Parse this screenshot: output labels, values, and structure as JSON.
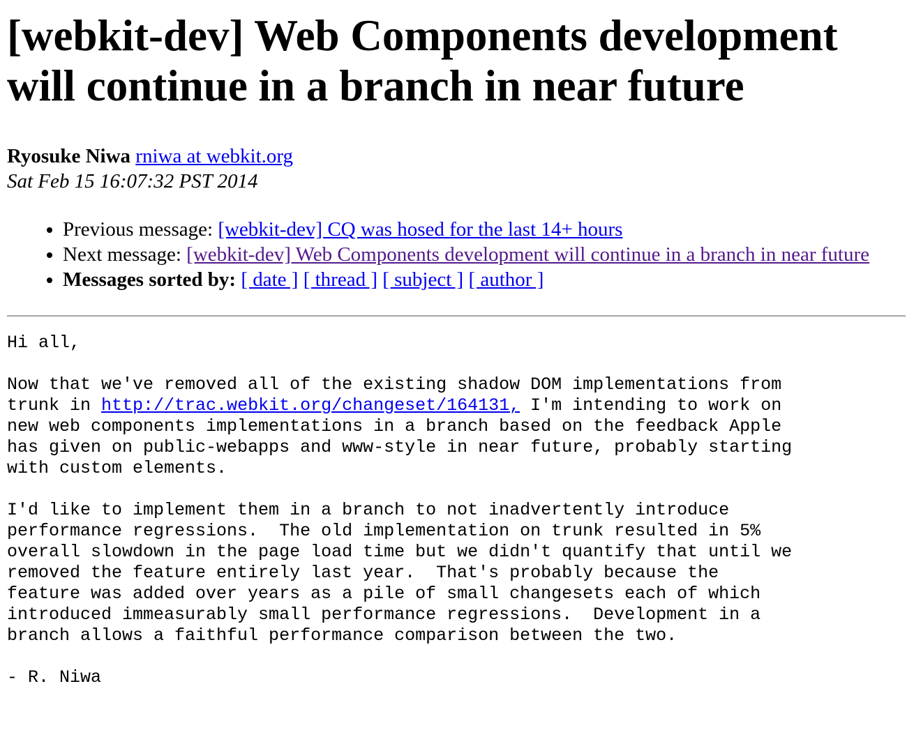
{
  "title": "[webkit-dev] Web Components development will continue in a branch in near future",
  "author": {
    "name": "Ryosuke Niwa",
    "email_link": "rniwa at webkit.org "
  },
  "date": "Sat Feb 15 16:07:32 PST 2014",
  "nav": {
    "previous_label": "Previous message: ",
    "previous_link": "[webkit-dev] CQ was hosed for the last 14+ hours",
    "next_label": "Next message: ",
    "next_link": "[webkit-dev] Web Components development will continue in a branch in near future",
    "sorted_label": "Messages sorted by: ",
    "sort_date": "[ date ]",
    "sort_thread": "[ thread ]",
    "sort_subject": "[ subject ]",
    "sort_author": "[ author ]"
  },
  "body": {
    "line1": "Hi all,",
    "p1_before": "Now that we've removed all of the existing shadow DOM implementations from\ntrunk in ",
    "p1_link": "http://trac.webkit.org/changeset/164131,",
    "p1_after": " I'm intending to work on\nnew web components implementations in a branch based on the feedback Apple\nhas given on public-webapps and www-style in near future, probably starting\nwith custom elements.",
    "p2": "I'd like to implement them in a branch to not inadvertently introduce\nperformance regressions.  The old implementation on trunk resulted in 5%\noverall slowdown in the page load time but we didn't quantify that until we\nremoved the feature entirely last year.  That's probably because the\nfeature was added over years as a pile of small changesets each of which\nintroduced immeasurably small performance regressions.  Development in a\nbranch allows a faithful performance comparison between the two.",
    "signature": "- R. Niwa"
  }
}
